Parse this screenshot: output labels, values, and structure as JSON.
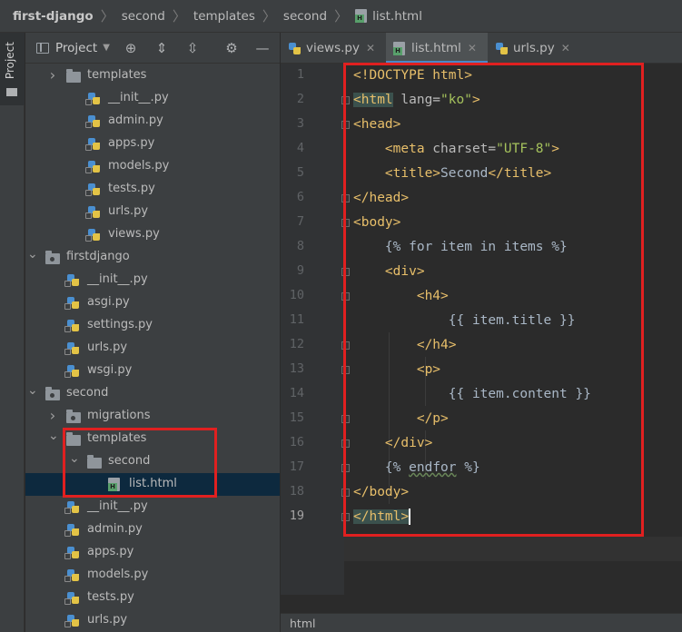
{
  "breadcrumb": {
    "items": [
      "first-django",
      "second",
      "templates",
      "second",
      "list.html"
    ]
  },
  "sidestrip": {
    "label": "Project"
  },
  "project_panel": {
    "title": "Project",
    "tools": [
      "crosshair-icon",
      "expand-all-icon",
      "collapse-all-icon",
      "gear-icon",
      "minimize-icon"
    ],
    "tree": [
      {
        "label": "templates",
        "type": "folder",
        "expanded": false
      },
      {
        "label": "__init__.py",
        "type": "py"
      },
      {
        "label": "admin.py",
        "type": "py"
      },
      {
        "label": "apps.py",
        "type": "py"
      },
      {
        "label": "models.py",
        "type": "py"
      },
      {
        "label": "tests.py",
        "type": "py"
      },
      {
        "label": "urls.py",
        "type": "py"
      },
      {
        "label": "views.py",
        "type": "py"
      },
      {
        "label": "firstdjango",
        "type": "package",
        "expanded": true
      },
      {
        "label": "__init__.py",
        "type": "py"
      },
      {
        "label": "asgi.py",
        "type": "py"
      },
      {
        "label": "settings.py",
        "type": "py"
      },
      {
        "label": "urls.py",
        "type": "py"
      },
      {
        "label": "wsgi.py",
        "type": "py"
      },
      {
        "label": "second",
        "type": "package",
        "expanded": true
      },
      {
        "label": "migrations",
        "type": "package",
        "expanded": false
      },
      {
        "label": "templates",
        "type": "folder",
        "expanded": true
      },
      {
        "label": "second",
        "type": "folder",
        "expanded": true
      },
      {
        "label": "list.html",
        "type": "html",
        "selected": true
      },
      {
        "label": "__init__.py",
        "type": "py"
      },
      {
        "label": "admin.py",
        "type": "py"
      },
      {
        "label": "apps.py",
        "type": "py"
      },
      {
        "label": "models.py",
        "type": "py"
      },
      {
        "label": "tests.py",
        "type": "py"
      },
      {
        "label": "urls.py",
        "type": "py"
      }
    ]
  },
  "editor": {
    "tabs": [
      {
        "label": "views.py",
        "type": "py",
        "active": false
      },
      {
        "label": "list.html",
        "type": "html",
        "active": true
      },
      {
        "label": "urls.py",
        "type": "py",
        "active": false
      }
    ],
    "line_numbers": [
      "1",
      "2",
      "3",
      "4",
      "5",
      "6",
      "7",
      "8",
      "9",
      "10",
      "11",
      "12",
      "13",
      "14",
      "15",
      "16",
      "17",
      "18",
      "19"
    ],
    "current_line": "19",
    "code": {
      "l1_doctype": "<!DOCTYPE html>",
      "l2_open": "<html",
      "l2_attr": " lang=",
      "l2_val": "\"ko\"",
      "l2_close": ">",
      "l3": "<head>",
      "l4_open": "<meta",
      "l4_attr": " charset=",
      "l4_val": "\"UTF-8\"",
      "l4_close": ">",
      "l5_open": "<title>",
      "l5_text": "Second",
      "l5_close": "</title>",
      "l6": "</head>",
      "l7": "<body>",
      "l8": "{% for item in items %}",
      "l9": "<div>",
      "l10": "<h4>",
      "l11": "{{ item.title }}",
      "l12": "</h4>",
      "l13": "<p>",
      "l14": "{{ item.content }}",
      "l15": "</p>",
      "l16": "</div>",
      "l17_a": "{% ",
      "l17_b": "endfor",
      "l17_c": " %}",
      "l18": "</body>",
      "l19_open": "</html",
      "l19_close": ">"
    }
  },
  "status_bar": {
    "text": "html"
  },
  "colors": {
    "highlight_box": "#e02020",
    "tag": "#e8bf6a",
    "string": "#a5c25c"
  }
}
